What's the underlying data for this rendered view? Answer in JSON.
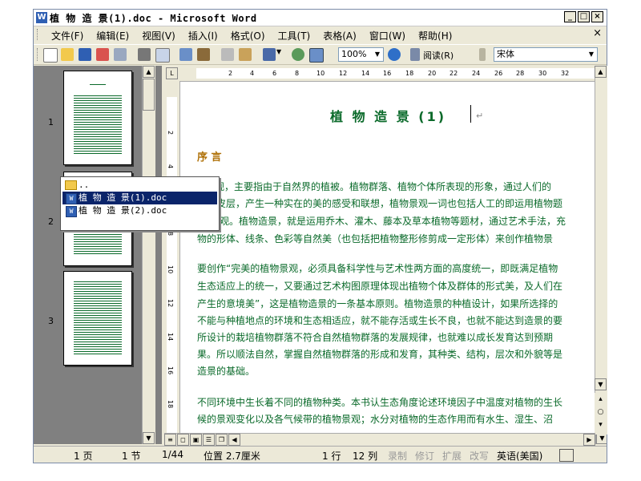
{
  "window": {
    "title": "植 物 造 景(1).doc - Microsoft Word",
    "buttons": {
      "minimize": "_",
      "maximize": "□",
      "close": "×"
    }
  },
  "menu": {
    "items": [
      "文件(F)",
      "编辑(E)",
      "视图(V)",
      "插入(I)",
      "格式(O)",
      "工具(T)",
      "表格(A)",
      "窗口(W)",
      "帮助(H)"
    ],
    "close": "×"
  },
  "toolbar": {
    "zoom": "100%",
    "read_label": "阅读(R)",
    "font": "宋体"
  },
  "ruler": {
    "ticks": [
      "2",
      "4",
      "6",
      "8",
      "10",
      "12",
      "14",
      "16",
      "18",
      "20",
      "22",
      "24",
      "26",
      "28",
      "30",
      "32"
    ],
    "vticks": [
      "2",
      "4",
      "6",
      "8",
      "10",
      "12",
      "14",
      "16",
      "18",
      "20"
    ]
  },
  "thumbnails": {
    "pages": [
      "1",
      "2",
      "3"
    ]
  },
  "dropdown": {
    "items": [
      "..",
      "植 物 造 景(1).doc",
      "植 物 造 景(2).doc"
    ],
    "selected_index": 1
  },
  "document": {
    "title": "植 物 造 景 (1)",
    "heading": "序 言",
    "para1": [
      "景观，主要指由于自然界的植被。植物群落、植物个体所表现的形象，通过人们的",
      "皮层，产生一种实在的美的感受和联想，植物景观一词也包括人工的即运用植物题",
      "观。植物造景，就是运用乔木、灌木、藤本及草本植物等题材，通过艺术手法，充",
      "物的形体、线条、色彩等自然美（也包括把植物整形修剪成一定形体）来创作植物景"
    ],
    "para2": [
      "要创作“完美的植物景观，必须具备科学性与艺术性两方面的高度统一，即既满足植物",
      "生态适应上的统一，又要通过艺术构图原理体现出植物个体及群体的形式美，及人们在",
      "产生的意境美”，这是植物造景的一条基本原则。植物造景的种植设计，如果所选择的",
      "不能与种植地点的环境和生态相适应，就不能存活或生长不良，也就不能达到造景的要",
      "所设计的栽培植物群落不符合自然植物群落的发展规律，也就难以成长发育达到预期",
      "果。所以顺法自然，掌握自然植物群落的形成和发育，其种类、结构，层次和外貌等是",
      "造景的基础。"
    ],
    "para3": [
      "不同环境中生长着不同的植物种类。本书认生态角度论述环境因子中温度对植物的生长",
      "候的景观变化以及各气候带的植物景观；水分对植物的生态作用而有水生、湿生、沼"
    ]
  },
  "status": {
    "page": "1 页",
    "section": "1 节",
    "count": "1/44",
    "position": "位置 2.7厘米",
    "line": "1 行",
    "column": "12 列",
    "rec": "录制",
    "trk": "修订",
    "ext": "扩展",
    "ovr": "改写",
    "lang": "英语(美国)"
  },
  "colors": {
    "text_green": "#0a6a2a",
    "heading_orange": "#b0720a",
    "selection": "#0a246a"
  }
}
